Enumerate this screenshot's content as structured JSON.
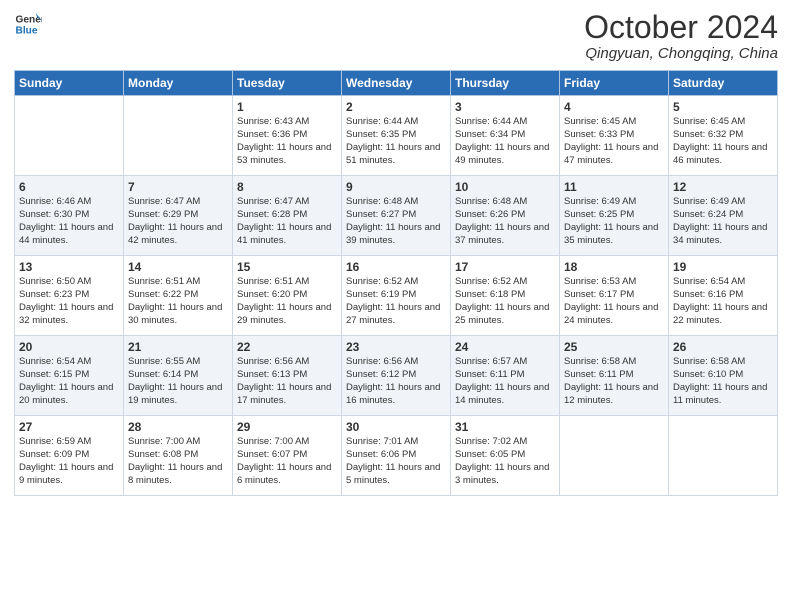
{
  "header": {
    "logo_line1": "General",
    "logo_line2": "Blue",
    "month": "October 2024",
    "location": "Qingyuan, Chongqing, China"
  },
  "weekdays": [
    "Sunday",
    "Monday",
    "Tuesday",
    "Wednesday",
    "Thursday",
    "Friday",
    "Saturday"
  ],
  "weeks": [
    [
      {
        "day": "",
        "text": ""
      },
      {
        "day": "",
        "text": ""
      },
      {
        "day": "1",
        "text": "Sunrise: 6:43 AM\nSunset: 6:36 PM\nDaylight: 11 hours and 53 minutes."
      },
      {
        "day": "2",
        "text": "Sunrise: 6:44 AM\nSunset: 6:35 PM\nDaylight: 11 hours and 51 minutes."
      },
      {
        "day": "3",
        "text": "Sunrise: 6:44 AM\nSunset: 6:34 PM\nDaylight: 11 hours and 49 minutes."
      },
      {
        "day": "4",
        "text": "Sunrise: 6:45 AM\nSunset: 6:33 PM\nDaylight: 11 hours and 47 minutes."
      },
      {
        "day": "5",
        "text": "Sunrise: 6:45 AM\nSunset: 6:32 PM\nDaylight: 11 hours and 46 minutes."
      }
    ],
    [
      {
        "day": "6",
        "text": "Sunrise: 6:46 AM\nSunset: 6:30 PM\nDaylight: 11 hours and 44 minutes."
      },
      {
        "day": "7",
        "text": "Sunrise: 6:47 AM\nSunset: 6:29 PM\nDaylight: 11 hours and 42 minutes."
      },
      {
        "day": "8",
        "text": "Sunrise: 6:47 AM\nSunset: 6:28 PM\nDaylight: 11 hours and 41 minutes."
      },
      {
        "day": "9",
        "text": "Sunrise: 6:48 AM\nSunset: 6:27 PM\nDaylight: 11 hours and 39 minutes."
      },
      {
        "day": "10",
        "text": "Sunrise: 6:48 AM\nSunset: 6:26 PM\nDaylight: 11 hours and 37 minutes."
      },
      {
        "day": "11",
        "text": "Sunrise: 6:49 AM\nSunset: 6:25 PM\nDaylight: 11 hours and 35 minutes."
      },
      {
        "day": "12",
        "text": "Sunrise: 6:49 AM\nSunset: 6:24 PM\nDaylight: 11 hours and 34 minutes."
      }
    ],
    [
      {
        "day": "13",
        "text": "Sunrise: 6:50 AM\nSunset: 6:23 PM\nDaylight: 11 hours and 32 minutes."
      },
      {
        "day": "14",
        "text": "Sunrise: 6:51 AM\nSunset: 6:22 PM\nDaylight: 11 hours and 30 minutes."
      },
      {
        "day": "15",
        "text": "Sunrise: 6:51 AM\nSunset: 6:20 PM\nDaylight: 11 hours and 29 minutes."
      },
      {
        "day": "16",
        "text": "Sunrise: 6:52 AM\nSunset: 6:19 PM\nDaylight: 11 hours and 27 minutes."
      },
      {
        "day": "17",
        "text": "Sunrise: 6:52 AM\nSunset: 6:18 PM\nDaylight: 11 hours and 25 minutes."
      },
      {
        "day": "18",
        "text": "Sunrise: 6:53 AM\nSunset: 6:17 PM\nDaylight: 11 hours and 24 minutes."
      },
      {
        "day": "19",
        "text": "Sunrise: 6:54 AM\nSunset: 6:16 PM\nDaylight: 11 hours and 22 minutes."
      }
    ],
    [
      {
        "day": "20",
        "text": "Sunrise: 6:54 AM\nSunset: 6:15 PM\nDaylight: 11 hours and 20 minutes."
      },
      {
        "day": "21",
        "text": "Sunrise: 6:55 AM\nSunset: 6:14 PM\nDaylight: 11 hours and 19 minutes."
      },
      {
        "day": "22",
        "text": "Sunrise: 6:56 AM\nSunset: 6:13 PM\nDaylight: 11 hours and 17 minutes."
      },
      {
        "day": "23",
        "text": "Sunrise: 6:56 AM\nSunset: 6:12 PM\nDaylight: 11 hours and 16 minutes."
      },
      {
        "day": "24",
        "text": "Sunrise: 6:57 AM\nSunset: 6:11 PM\nDaylight: 11 hours and 14 minutes."
      },
      {
        "day": "25",
        "text": "Sunrise: 6:58 AM\nSunset: 6:11 PM\nDaylight: 11 hours and 12 minutes."
      },
      {
        "day": "26",
        "text": "Sunrise: 6:58 AM\nSunset: 6:10 PM\nDaylight: 11 hours and 11 minutes."
      }
    ],
    [
      {
        "day": "27",
        "text": "Sunrise: 6:59 AM\nSunset: 6:09 PM\nDaylight: 11 hours and 9 minutes."
      },
      {
        "day": "28",
        "text": "Sunrise: 7:00 AM\nSunset: 6:08 PM\nDaylight: 11 hours and 8 minutes."
      },
      {
        "day": "29",
        "text": "Sunrise: 7:00 AM\nSunset: 6:07 PM\nDaylight: 11 hours and 6 minutes."
      },
      {
        "day": "30",
        "text": "Sunrise: 7:01 AM\nSunset: 6:06 PM\nDaylight: 11 hours and 5 minutes."
      },
      {
        "day": "31",
        "text": "Sunrise: 7:02 AM\nSunset: 6:05 PM\nDaylight: 11 hours and 3 minutes."
      },
      {
        "day": "",
        "text": ""
      },
      {
        "day": "",
        "text": ""
      }
    ]
  ]
}
